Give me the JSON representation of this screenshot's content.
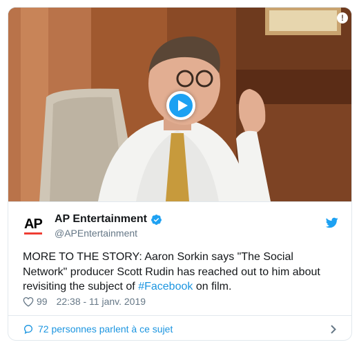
{
  "media": {
    "type": "video",
    "info_glyph": "!"
  },
  "account": {
    "logo_text": "AP",
    "display_name": "AP Entertainment",
    "handle": "@APEntertainment",
    "verified": true
  },
  "tweet": {
    "text_before": "MORE TO THE STORY: Aaron Sorkin says \"The Social Network\" producer Scott Rudin has reached out to him about revisiting the subject of ",
    "hashtag": "#Facebook",
    "text_after": " on film.",
    "likes": "99",
    "timestamp": "22:38 - 11 janv. 2019"
  },
  "footer": {
    "label": "72 personnes parlent à ce sujet"
  },
  "colors": {
    "twitter_blue": "#1da1f2",
    "link_blue": "#1b95e0",
    "ap_red": "#ef3d33",
    "muted": "#657786"
  },
  "icons": [
    "play-icon",
    "info-icon",
    "verified-badge-icon",
    "twitter-bird-icon",
    "heart-icon",
    "speech-bubble-icon",
    "chevron-right-icon"
  ]
}
